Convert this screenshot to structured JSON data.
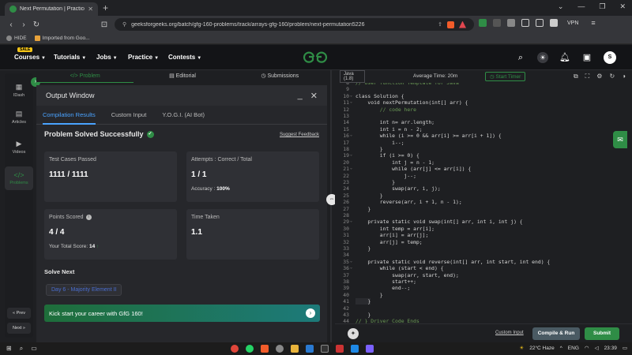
{
  "browser": {
    "tab_title": "Next Permutation | Practice | Ge",
    "url": "geeksforgeeks.org/batch/gfg-160-problems/track/arrays-gfg-160/problem/next-permutation5226",
    "vpn_label": "VPN",
    "bookmarks": [
      "HIDE",
      "Imported from Goo..."
    ]
  },
  "gfg_nav": {
    "sale_badge": "SALE",
    "items": [
      "Courses",
      "Tutorials",
      "Jobs",
      "Practice",
      "Contests"
    ],
    "logo": "GG",
    "avatar_letter": "S"
  },
  "sidebar": {
    "items": [
      "IDash",
      "Articles",
      "Videos",
      "Problems"
    ],
    "prev": "« Prev",
    "next": "Next »"
  },
  "problem_tabs": [
    "Problem",
    "Editorial",
    "Submissions"
  ],
  "output": {
    "title": "Output Window",
    "tabs": [
      "Compilation Results",
      "Custom Input",
      "Y.O.G.I. (AI Bot)"
    ],
    "status": "Problem Solved Successfully",
    "feedback": "Suggest Feedback",
    "cards": {
      "test_cases_label": "Test Cases Passed",
      "test_cases_value": "1111 / 1111",
      "attempts_label": "Attempts : Correct / Total",
      "attempts_value": "1 / 1",
      "accuracy_label": "Accuracy : ",
      "accuracy_value": "100%",
      "points_label": "Points Scored",
      "points_value": "4 / 4",
      "total_score_label": "Your Total Score: ",
      "total_score_value": "14",
      "time_label": "Time Taken",
      "time_value": "1.1"
    },
    "solve_next_label": "Solve Next",
    "solve_next_item": "Day 6 - Majority Element II",
    "career_banner": "Kick start your career with GfG 160!"
  },
  "editor": {
    "language": "Java (1.8)",
    "avg_time": "Average Time: 20m",
    "start_timer": "Start Timer",
    "custom_input": "Custom Input",
    "compile_run": "Compile & Run",
    "submit": "Submit",
    "code_lines": [
      {
        "n": "8",
        "t": "// User function Template for Java"
      },
      {
        "n": "9",
        "t": ""
      },
      {
        "n": "10",
        "t": "class Solution {"
      },
      {
        "n": "11",
        "t": "    void nextPermutation(int[] arr) {"
      },
      {
        "n": "12",
        "t": "        // code here"
      },
      {
        "n": "13",
        "t": ""
      },
      {
        "n": "14",
        "t": "        int n= arr.length;"
      },
      {
        "n": "15",
        "t": "        int i = n - 2;"
      },
      {
        "n": "16",
        "t": "        while (i >= 0 && arr[i] >= arr[i + 1]) {"
      },
      {
        "n": "17",
        "t": "            i--;"
      },
      {
        "n": "18",
        "t": "        }"
      },
      {
        "n": "19",
        "t": "        if (i >= 0) {"
      },
      {
        "n": "20",
        "t": "            int j = n - 1;"
      },
      {
        "n": "21",
        "t": "            while (arr[j] <= arr[i]) {"
      },
      {
        "n": "22",
        "t": "                j--;"
      },
      {
        "n": "23",
        "t": "            }"
      },
      {
        "n": "24",
        "t": "            swap(arr, i, j);"
      },
      {
        "n": "25",
        "t": "        }"
      },
      {
        "n": "26",
        "t": "        reverse(arr, i + 1, n - 1);"
      },
      {
        "n": "27",
        "t": "    }"
      },
      {
        "n": "28",
        "t": ""
      },
      {
        "n": "29",
        "t": "    private static void swap(int[] arr, int i, int j) {"
      },
      {
        "n": "30",
        "t": "        int temp = arr[i];"
      },
      {
        "n": "31",
        "t": "        arr[i] = arr[j];"
      },
      {
        "n": "32",
        "t": "        arr[j] = temp;"
      },
      {
        "n": "33",
        "t": "    }"
      },
      {
        "n": "34",
        "t": ""
      },
      {
        "n": "35",
        "t": "    private static void reverse(int[] arr, int start, int end) {"
      },
      {
        "n": "36",
        "t": "        while (start < end) {"
      },
      {
        "n": "37",
        "t": "            swap(arr, start, end);"
      },
      {
        "n": "38",
        "t": "            start++;"
      },
      {
        "n": "39",
        "t": "            end--;"
      },
      {
        "n": "40",
        "t": "        }"
      },
      {
        "n": "41",
        "t": "    }"
      },
      {
        "n": "42",
        "t": ""
      },
      {
        "n": "43",
        "t": "    }"
      },
      {
        "n": "44",
        "t": "// } Driver Code Ends"
      }
    ]
  },
  "taskbar": {
    "weather": "22°C Haze",
    "lang": "ENG",
    "time": "23:39"
  }
}
